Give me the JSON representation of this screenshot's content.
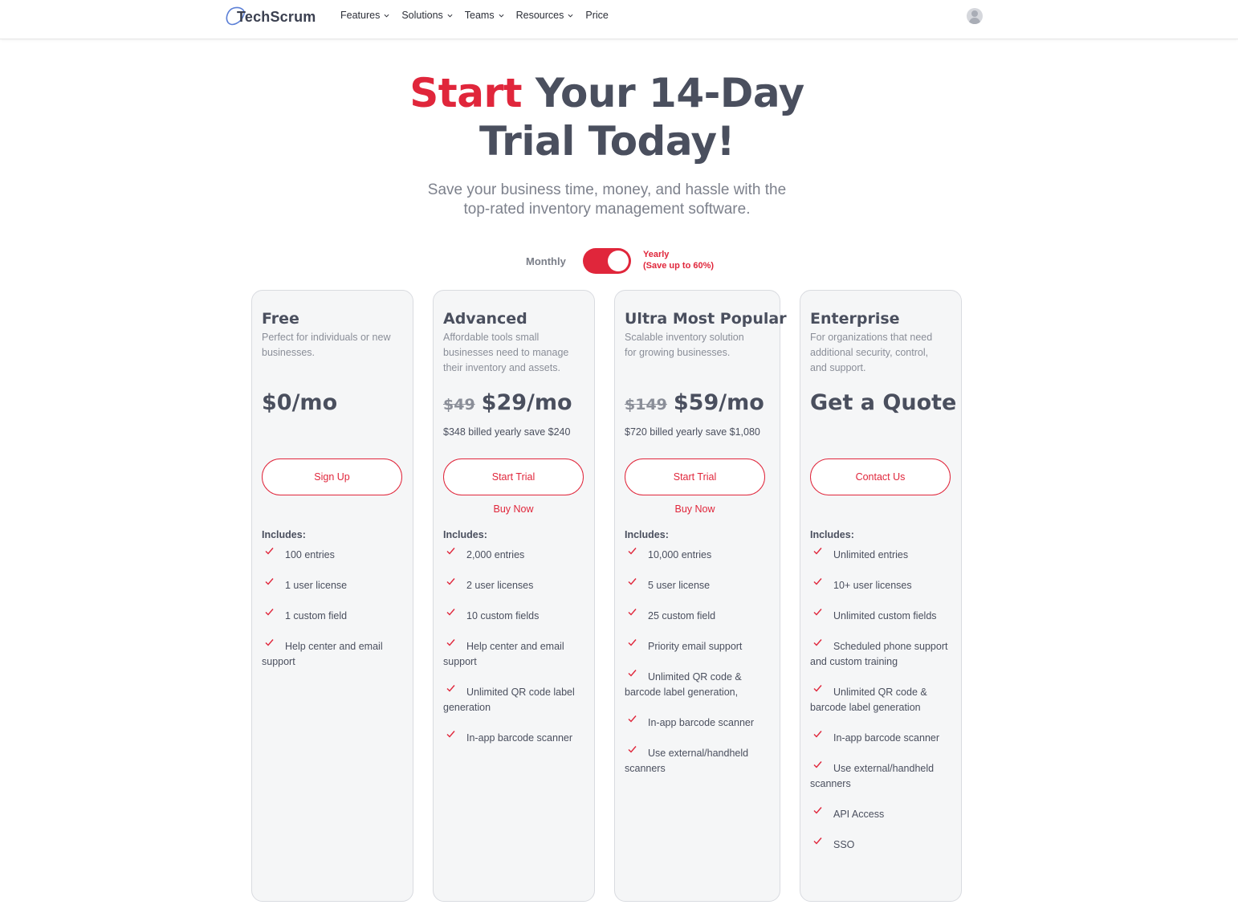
{
  "brand": {
    "name": "TechScrum"
  },
  "nav": {
    "items": [
      {
        "label": "Features",
        "dropdown": true
      },
      {
        "label": "Solutions",
        "dropdown": true
      },
      {
        "label": "Teams",
        "dropdown": true
      },
      {
        "label": "Resources",
        "dropdown": true
      },
      {
        "label": "Price",
        "dropdown": false
      }
    ]
  },
  "hero": {
    "title_accent": "Start",
    "title_rest_line1": " Your 14-Day",
    "title_line2": "Trial Today!",
    "subtitle_line1": "Save your business time, money, and hassle with the",
    "subtitle_line2": "top-rated inventory management software."
  },
  "billing_toggle": {
    "monthly_label": "Monthly",
    "yearly_label": "Yearly",
    "yearly_note": "(Save up to 60%)",
    "selected": "Yearly"
  },
  "colors": {
    "accent": "#e0263b",
    "text": "#4a4f5e",
    "muted": "#8a8e98",
    "card_bg": "#f5f6f7"
  },
  "plans": [
    {
      "name": "Free",
      "description": "Perfect for individuals or new businesses.",
      "old_price": "",
      "price": "$0/mo",
      "billed": "",
      "primary_button": "Sign Up",
      "secondary_link": "",
      "includes_label": "Includes:",
      "features": [
        "100 entries",
        "1 user license",
        "1 custom field",
        "Help center and email support"
      ]
    },
    {
      "name": "Advanced",
      "description": "Affordable tools small businesses need to manage their inventory and assets.",
      "old_price": "$49",
      "price": "$29/mo",
      "billed": "$348 billed yearly save $240",
      "primary_button": "Start Trial",
      "secondary_link": "Buy Now",
      "includes_label": "Includes:",
      "features": [
        "2,000 entries",
        "2 user licenses",
        "10 custom fields",
        "Help center and email support",
        "Unlimited QR code label generation",
        "In-app barcode scanner"
      ]
    },
    {
      "name": "Ultra Most Popular",
      "description": "Scalable inventory solution for growing businesses.",
      "old_price": "$149",
      "price": "$59/mo",
      "billed": "$720 billed yearly save $1,080",
      "primary_button": "Start Trial",
      "secondary_link": "Buy Now",
      "includes_label": "Includes:",
      "features": [
        "10,000 entries",
        "5 user license",
        "25 custom field",
        "Priority email support",
        "Unlimited QR code & barcode label generation,",
        "In-app barcode scanner",
        "Use external/handheld scanners"
      ]
    },
    {
      "name": "Enterprise",
      "description": "For organizations that need additional security, control, and support.",
      "old_price": "",
      "price": "Get a Quote",
      "billed": "",
      "primary_button": "Contact Us",
      "secondary_link": "",
      "includes_label": "Includes:",
      "features": [
        "Unlimited entries",
        "10+ user licenses",
        "Unlimited custom fields",
        "Scheduled phone support and custom training",
        "Unlimited QR code & barcode label generation",
        "In-app barcode scanner",
        "Use external/handheld scanners",
        "API Access",
        "SSO"
      ]
    }
  ]
}
